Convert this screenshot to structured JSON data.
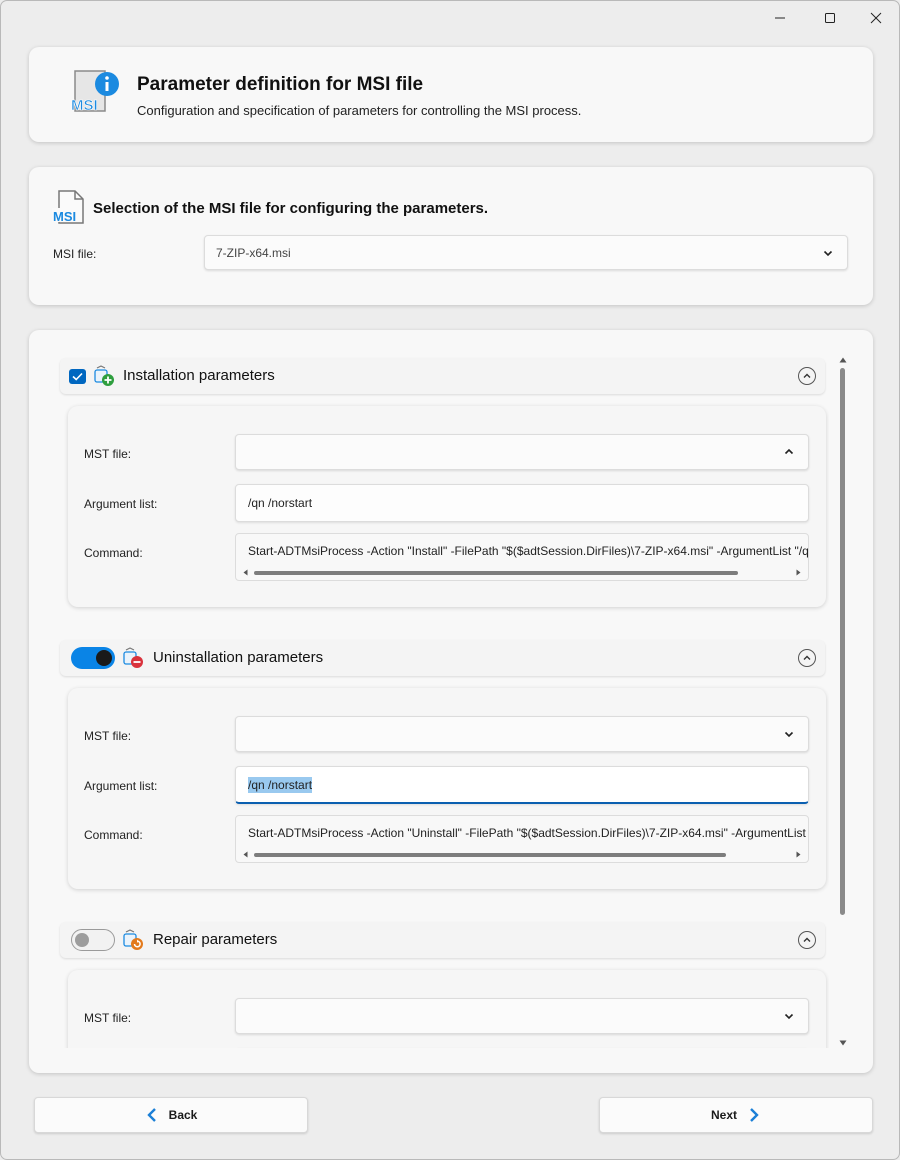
{
  "window": {
    "controls": [
      "minimize",
      "maximize",
      "close"
    ]
  },
  "header": {
    "title": "Parameter definition for MSI file",
    "subtitle": "Configuration and specification of parameters for controlling the MSI process.",
    "icon": "msi-info-icon",
    "icon_text": "MSI"
  },
  "selection": {
    "title": "Selection of the MSI file for configuring the parameters.",
    "icon_text": "MSI",
    "msi_file_label": "MSI file:",
    "msi_file_value": "7-ZIP-x64.msi"
  },
  "sections": {
    "install": {
      "title": "Installation parameters",
      "enabled": true,
      "control": "checkbox",
      "mst_label": "MST file:",
      "mst_value": "",
      "args_label": "Argument list:",
      "args_value": "/qn /norstart",
      "command_label": "Command:",
      "command_value": "Start-ADTMsiProcess -Action \"Install\" -FilePath \"$($adtSession.DirFiles)\\7-ZIP-x64.msi\" -ArgumentList \"/q"
    },
    "uninstall": {
      "title": "Uninstallation parameters",
      "enabled": true,
      "control": "toggle",
      "mst_label": "MST file:",
      "mst_value": "",
      "args_label": "Argument list:",
      "args_value": "/qn /norstart",
      "command_label": "Command:",
      "command_value": "Start-ADTMsiProcess -Action \"Uninstall\" -FilePath \"$($adtSession.DirFiles)\\7-ZIP-x64.msi\" -ArgumentList '"
    },
    "repair": {
      "title": "Repair parameters",
      "enabled": false,
      "control": "toggle",
      "mst_label": "MST file:",
      "mst_value": ""
    }
  },
  "footer": {
    "back_label": "Back",
    "next_label": "Next"
  },
  "colors": {
    "accent": "#0a84e6",
    "checkbox": "#0067c0",
    "icon_blue": "#1b8ae0",
    "remove_red": "#d9323c",
    "add_green": "#2e9e3e",
    "repair_orange": "#e37a1c"
  }
}
